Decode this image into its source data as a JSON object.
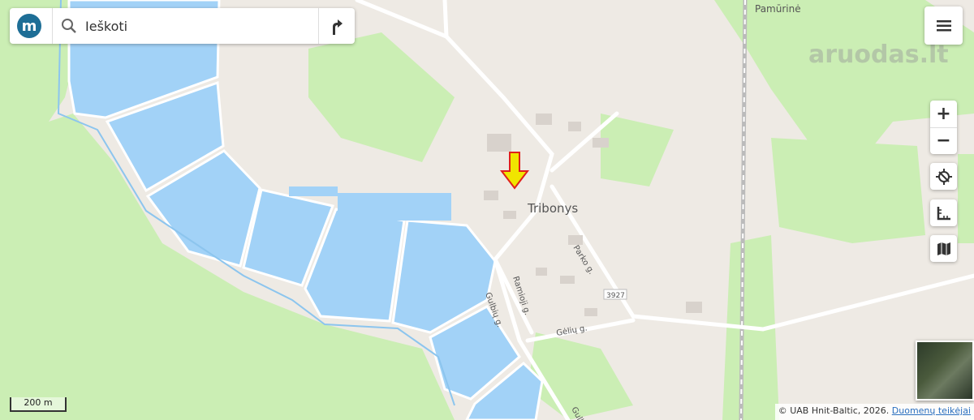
{
  "search": {
    "placeholder": "Ieškoti",
    "logo_letter": "m"
  },
  "map_labels": {
    "town": "Tribonys",
    "village": "Pamūrinė",
    "street_parko": "Parko g.",
    "street_ramioji": "Ramioji g.",
    "street_gulbiu": "Gulbių g.",
    "street_geliu": "Gėlių g.",
    "street_gulb2": "Gulb",
    "road_number": "3927"
  },
  "watermark": "aruodas.lt",
  "controls": {
    "zoom_in": "+",
    "zoom_out": "−"
  },
  "scale_label": "200 m",
  "attribution": {
    "text": "© UAB Hnit-Baltic, 2026. ",
    "link": "Duomenų teikėjai"
  },
  "colors": {
    "water": "#a2d2f7",
    "forest": "#cbeeb4",
    "land": "#eeeae4",
    "road": "#ffffff",
    "marker": "#f0e500"
  },
  "icons": [
    "search-icon",
    "route-icon",
    "menu-icon",
    "locate-icon",
    "measure-icon",
    "map-icon"
  ]
}
